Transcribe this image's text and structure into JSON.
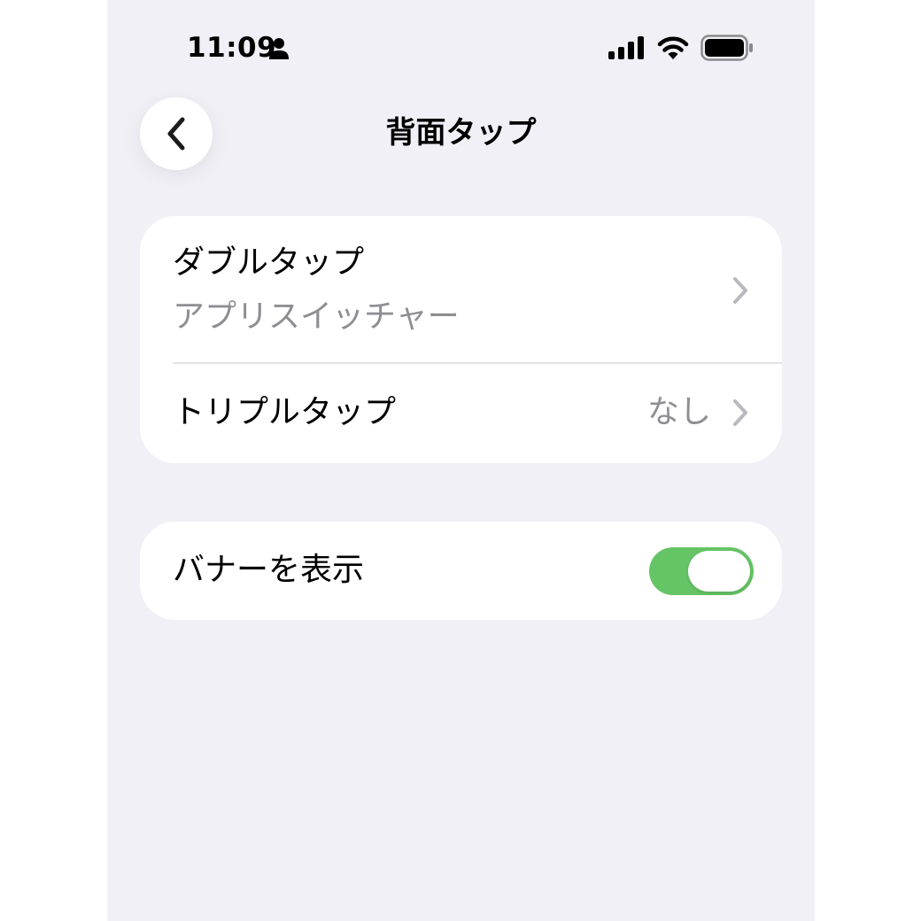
{
  "status_bar": {
    "time": "11:09",
    "icons": [
      "person-icon",
      "cellular-signal-icon",
      "wifi-icon",
      "battery-icon"
    ]
  },
  "nav": {
    "title": "背面タップ",
    "back_icon": "chevron-left-icon"
  },
  "groups": [
    {
      "rows": [
        {
          "title": "ダブルタップ",
          "subtitle": "アプリスイッチャー",
          "accessory": "chevron-right-icon"
        },
        {
          "title": "トリプルタップ",
          "value": "なし",
          "accessory": "chevron-right-icon"
        }
      ]
    },
    {
      "rows": [
        {
          "title": "バナーを表示",
          "toggle_on": true
        }
      ]
    }
  ],
  "colors": {
    "background": "#f1f0f6",
    "card": "#ffffff",
    "secondary_text": "#8e8e93",
    "toggle_on": "#65c466",
    "chevron": "#b9b9be"
  }
}
